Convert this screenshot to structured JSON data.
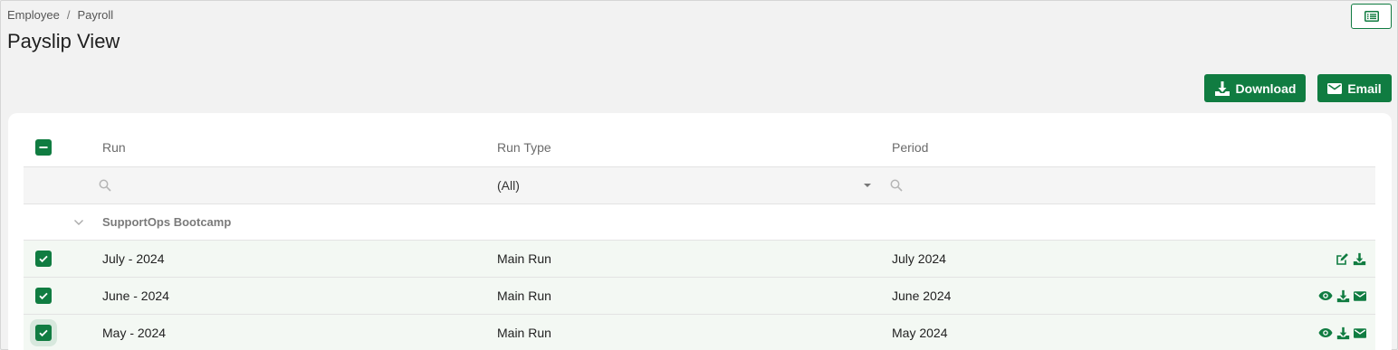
{
  "breadcrumb": {
    "items": [
      "Employee",
      "Payroll"
    ],
    "separator": "/"
  },
  "page": {
    "title": "Payslip View"
  },
  "toolbar": {
    "download_label": "Download",
    "email_label": "Email"
  },
  "colors": {
    "accent": "#107c41",
    "row_selected_bg": "#f3f8f3"
  },
  "grid": {
    "columns": {
      "run": "Run",
      "run_type": "Run Type",
      "period": "Period"
    },
    "filters": {
      "run_type_value": "(All)"
    },
    "group": {
      "label": "SupportOps Bootcamp"
    },
    "rows": [
      {
        "run": "July - 2024",
        "run_type": "Main Run",
        "period": "July 2024",
        "checked": true,
        "actions": [
          "edit-icon",
          "download-icon"
        ]
      },
      {
        "run": "June - 2024",
        "run_type": "Main Run",
        "period": "June 2024",
        "checked": true,
        "actions": [
          "view-icon",
          "download-icon",
          "email-icon"
        ]
      },
      {
        "run": "May - 2024",
        "run_type": "Main Run",
        "period": "May 2024",
        "checked": true,
        "actions": [
          "view-icon",
          "download-icon",
          "email-icon"
        ]
      }
    ]
  }
}
